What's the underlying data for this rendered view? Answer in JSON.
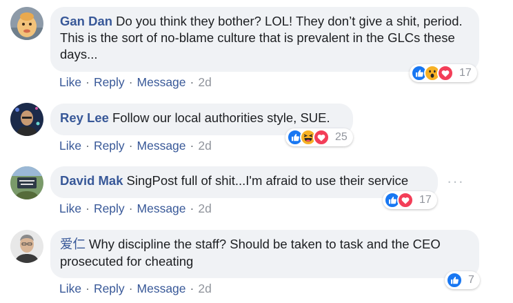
{
  "comments": [
    {
      "author": "Gan Dan",
      "text": "Do you think they bother? LOL! They don’t give a shit, period. This is the sort of no-blame culture that is prevalent in the GLCs these days...",
      "actions": {
        "like": "Like",
        "reply": "Reply",
        "message": "Message",
        "sep": "·",
        "time": "2d"
      },
      "reactions": {
        "icons": [
          "like-icon",
          "wow-icon",
          "love-icon"
        ],
        "count": "17"
      }
    },
    {
      "author": "Rey Lee",
      "text": "Follow our local authorities style, SUE.",
      "actions": {
        "like": "Like",
        "reply": "Reply",
        "message": "Message",
        "sep": "·",
        "time": "2d"
      },
      "reactions": {
        "icons": [
          "like-icon",
          "haha-icon",
          "love-icon"
        ],
        "count": "25"
      }
    },
    {
      "author": "David Mak",
      "text": "SingPost full of shit...I'm afraid to use their service",
      "actions": {
        "like": "Like",
        "reply": "Reply",
        "message": "Message",
        "sep": "·",
        "time": "2d"
      },
      "reactions": {
        "icons": [
          "like-icon",
          "love-icon"
        ],
        "count": "17"
      },
      "more_icon": "···"
    },
    {
      "author": "爱仁",
      "text": "Why discipline the staff? Should be taken to task and the CEO prosecuted for cheating",
      "actions": {
        "like": "Like",
        "reply": "Reply",
        "message": "Message",
        "sep": "·",
        "time": "2d"
      },
      "reactions": {
        "icons": [
          "like-icon"
        ],
        "count": "7"
      }
    }
  ],
  "colors": {
    "name": "#385898",
    "bubble": "#f0f2f5",
    "meta": "#606770",
    "like": "#1877f2",
    "love": "#f33e58",
    "yellow": "#f7b125"
  }
}
